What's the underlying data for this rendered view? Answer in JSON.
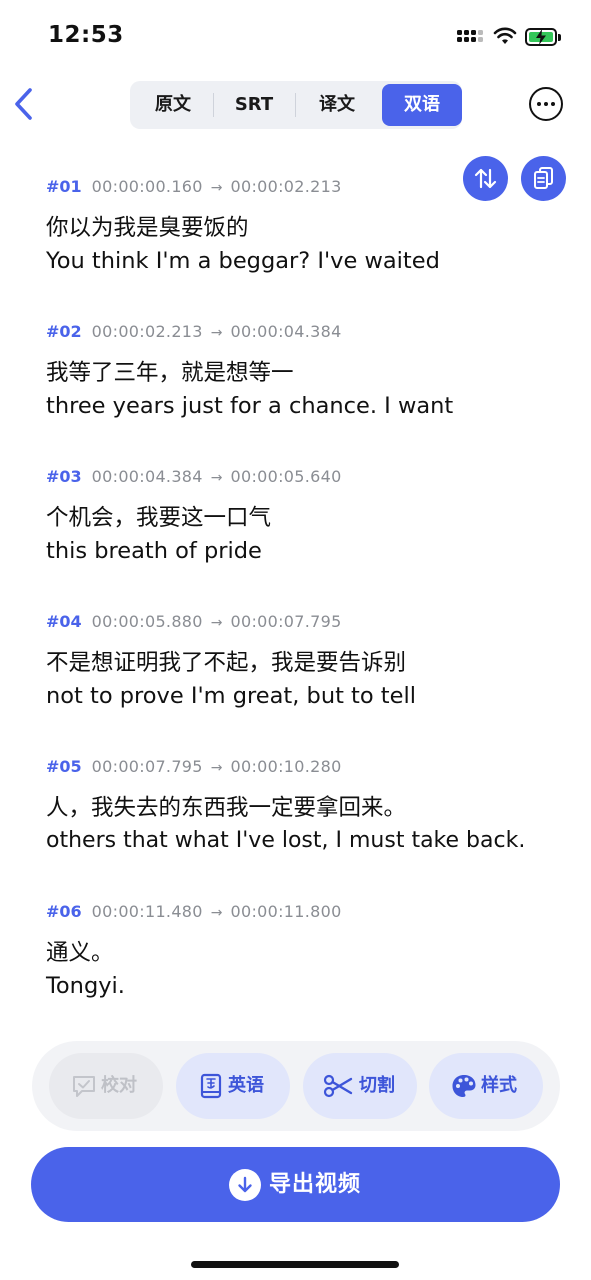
{
  "status_bar": {
    "time": "12:53"
  },
  "nav": {
    "tabs": [
      {
        "label": "原文",
        "active": false
      },
      {
        "label": "SRT",
        "active": false
      },
      {
        "label": "译文",
        "active": false
      },
      {
        "label": "双语",
        "active": true
      }
    ]
  },
  "subtitles": [
    {
      "index": "#01",
      "start": "00:00:00.160",
      "end": "00:00:02.213",
      "original": "你以为我是臭要饭的",
      "translation": "You think I'm a beggar? I've waited"
    },
    {
      "index": "#02",
      "start": "00:00:02.213",
      "end": "00:00:04.384",
      "original": "我等了三年，就是想等一",
      "translation": "three years just for a chance. I want"
    },
    {
      "index": "#03",
      "start": "00:00:04.384",
      "end": "00:00:05.640",
      "original": "个机会，我要这一口气",
      "translation": "this breath of pride"
    },
    {
      "index": "#04",
      "start": "00:00:05.880",
      "end": "00:00:07.795",
      "original": "不是想证明我了不起，我是要告诉别",
      "translation": "not to prove I'm great, but to tell"
    },
    {
      "index": "#05",
      "start": "00:00:07.795",
      "end": "00:00:10.280",
      "original": "人，我失去的东西我一定要拿回来。",
      "translation": "others that what I've lost, I must take back."
    },
    {
      "index": "#06",
      "start": "00:00:11.480",
      "end": "00:00:11.800",
      "original": "通义。",
      "translation": "Tongyi."
    }
  ],
  "toolbar": {
    "proofread": {
      "label": "校对",
      "icon": "chat-check-icon",
      "enabled": false
    },
    "language": {
      "label": "英语",
      "icon": "dictionary-icon",
      "enabled": true
    },
    "cut": {
      "label": "切割",
      "icon": "scissors-icon",
      "enabled": true
    },
    "style": {
      "label": "样式",
      "icon": "palette-icon",
      "enabled": true
    }
  },
  "export": {
    "label": "导出视频",
    "icon": "download-icon"
  },
  "colors": {
    "accent": "#4a63ea",
    "accent_light": "#e1e6fb",
    "timecode": "#8a8d93"
  }
}
